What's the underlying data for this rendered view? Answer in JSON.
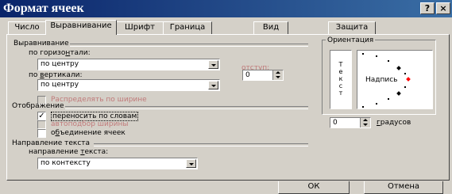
{
  "window": {
    "title": "Формат ячеек",
    "help": "?",
    "close": "×"
  },
  "tabs": [
    "Число",
    "Выравнивание",
    "Шрифт",
    "Граница",
    "Вид",
    "Защита"
  ],
  "alignment": {
    "section": "Выравнивание",
    "horizontal_label_pre": "по горизо",
    "horizontal_label_u": "н",
    "horizontal_label_post": "тали:",
    "horizontal_value": "по центру",
    "vertical_label_pre": "по ",
    "vertical_label_u": "в",
    "vertical_label_post": "ертикали:",
    "vertical_value": "по центру",
    "indent_label": "отступ:",
    "indent_value": "0",
    "distribute_label": "Распределять по ширине"
  },
  "display": {
    "section": "Отображение",
    "wrap_label": "переносить по словам",
    "autofit_label": "автоподбор ширины",
    "merge_label_pre": "о",
    "merge_label_u": "б",
    "merge_label_post": "ъединение ячеек",
    "wrap_checked": true
  },
  "direction": {
    "section": "Направление текста",
    "label_pre": "направление ",
    "label_u": "т",
    "label_post": "екста:",
    "value": "по контексту"
  },
  "orientation": {
    "section": "Ориентация",
    "vertical_text": [
      "Т",
      "е",
      "к",
      "с",
      "т"
    ],
    "inscription": "Надпись",
    "degrees_value": "0",
    "degrees_label_pre": "",
    "degrees_label_u": "г",
    "degrees_label_post": "радусов"
  },
  "buttons": {
    "ok": "ОК",
    "cancel": "Отмена"
  }
}
